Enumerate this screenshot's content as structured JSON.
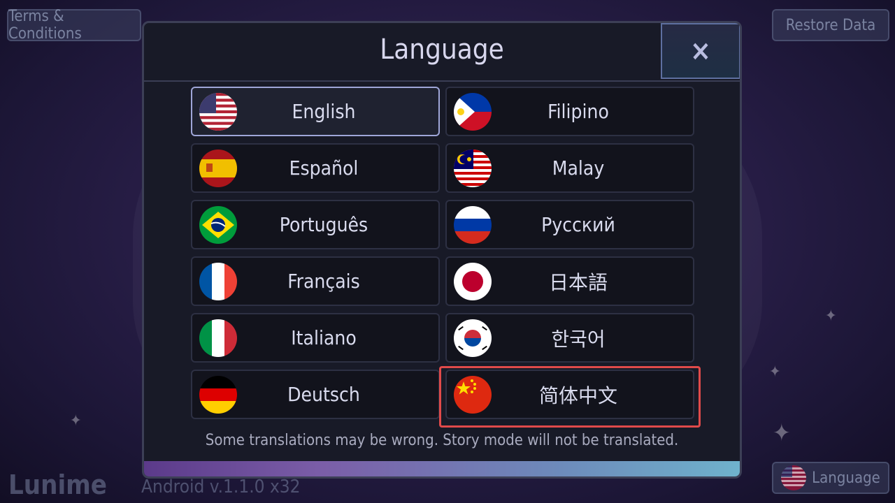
{
  "top_left_button": "Terms & Conditions",
  "top_right_button": "Restore Data",
  "bottom_right_button": "Language",
  "brand": "Lunime",
  "version": "Android v.1.1.0 x32",
  "dialog": {
    "title": "Language",
    "close_icon": "×",
    "note": "Some translations may be wrong. Story mode will not be translated.",
    "selected": "English",
    "highlighted": "简体中文",
    "languages": [
      {
        "label": "English",
        "flag": "us-flag-icon"
      },
      {
        "label": "Filipino",
        "flag": "philippines-flag-icon"
      },
      {
        "label": "Español",
        "flag": "spain-flag-icon"
      },
      {
        "label": "Malay",
        "flag": "malaysia-flag-icon"
      },
      {
        "label": "Português",
        "flag": "brazil-flag-icon"
      },
      {
        "label": "Русский",
        "flag": "russia-flag-icon"
      },
      {
        "label": "Français",
        "flag": "france-flag-icon"
      },
      {
        "label": "日本語",
        "flag": "japan-flag-icon"
      },
      {
        "label": "Italiano",
        "flag": "italy-flag-icon"
      },
      {
        "label": "한국어",
        "flag": "korea-flag-icon"
      },
      {
        "label": "Deutsch",
        "flag": "germany-flag-icon"
      },
      {
        "label": "简体中文",
        "flag": "china-flag-icon"
      }
    ]
  },
  "colors": {
    "dialog_bg": "#181a27",
    "selected_border": "#9fa6d8",
    "highlight_border": "#e04a4a"
  }
}
